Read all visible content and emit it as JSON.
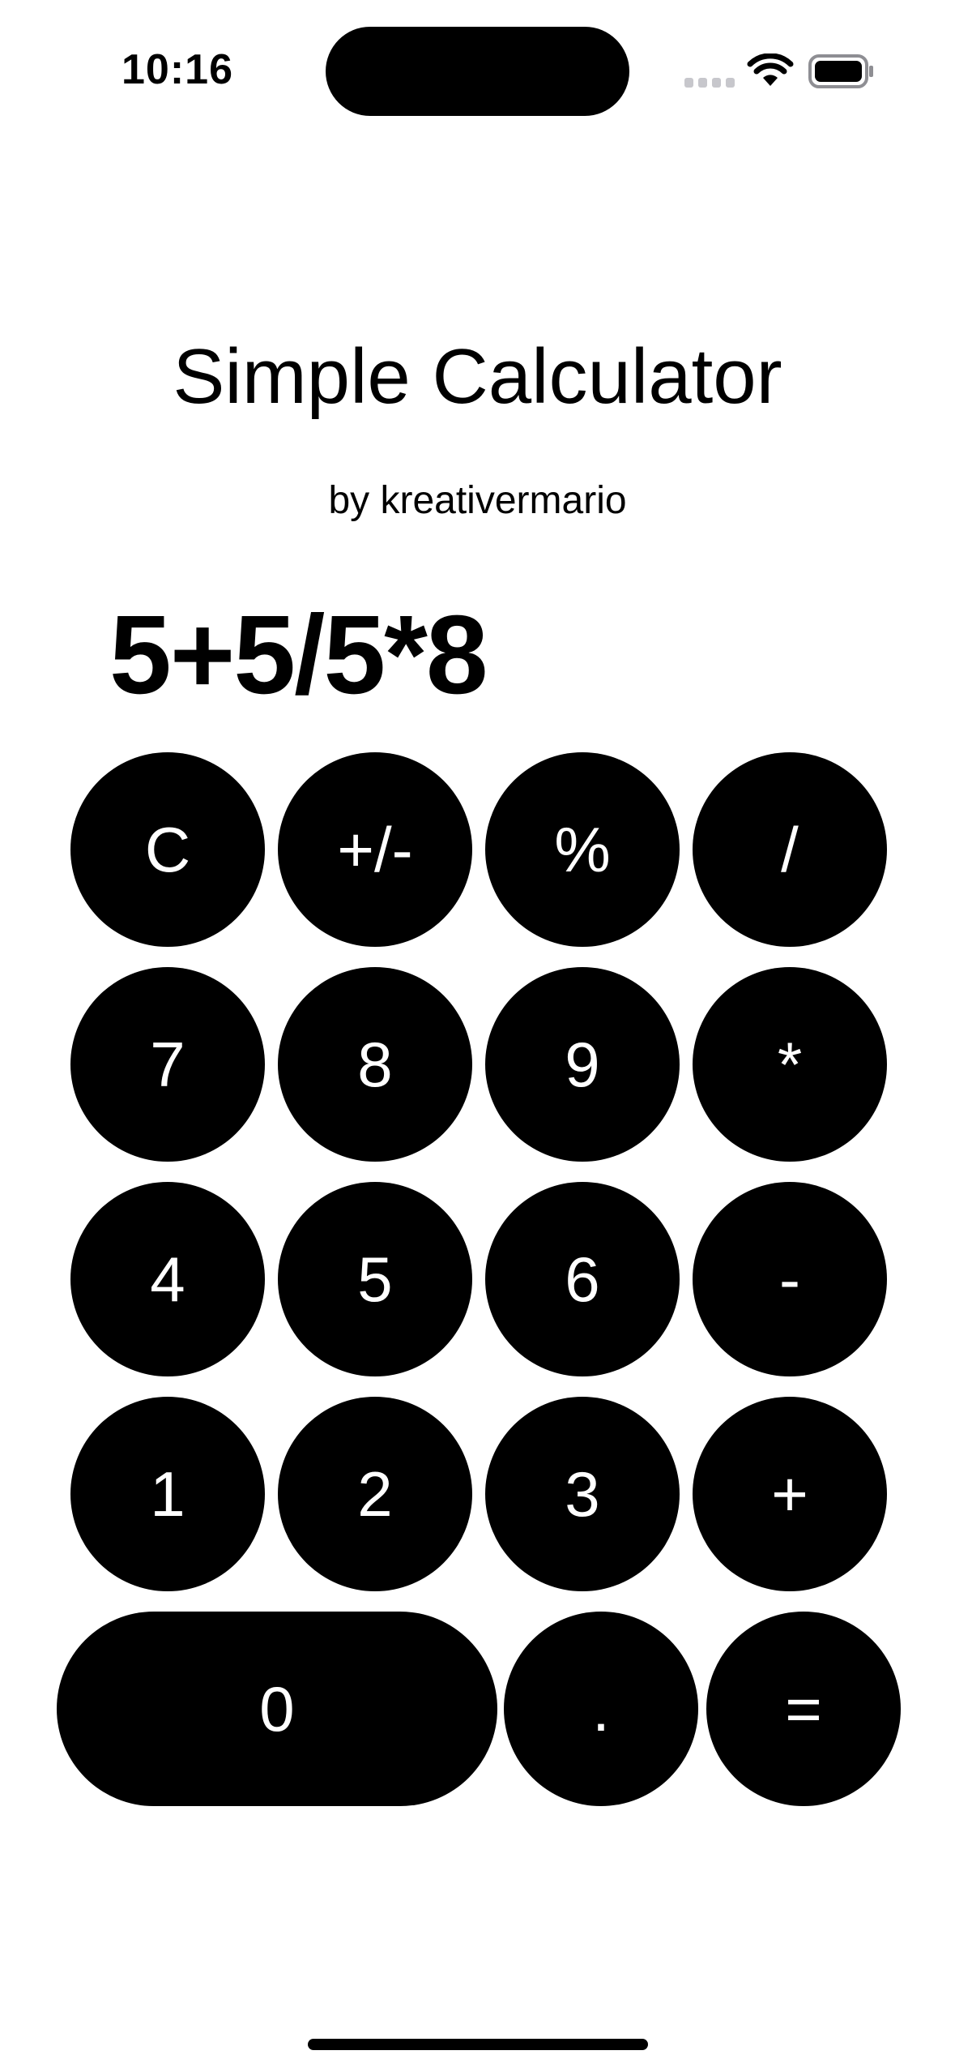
{
  "status_bar": {
    "time": "10:16"
  },
  "app": {
    "title": "Simple Calculator",
    "subtitle": "by kreativermario"
  },
  "display": {
    "expression": "5+5/5*8"
  },
  "keypad": {
    "rows": [
      [
        "C",
        "+/-",
        "%",
        "/"
      ],
      [
        "7",
        "8",
        "9",
        "*"
      ],
      [
        "4",
        "5",
        "6",
        "-"
      ],
      [
        "1",
        "2",
        "3",
        "+"
      ],
      [
        "0",
        ".",
        "="
      ]
    ]
  },
  "colors": {
    "background": "#ffffff",
    "key_background": "#000000",
    "key_text": "#ffffff"
  }
}
